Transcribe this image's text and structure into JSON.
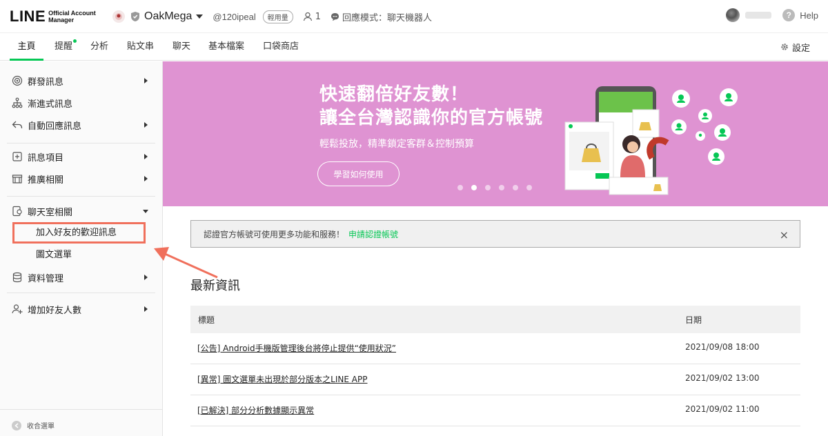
{
  "header": {
    "logo_main": "LINE",
    "logo_sub_1": "Official Account",
    "logo_sub_2": "Manager",
    "account_name": "OakMega",
    "account_id": "@120ipeal",
    "plan_badge": "輕用量",
    "friend_count": "1",
    "mode_label": "回應模式：聊天機器人",
    "help_label": "Help"
  },
  "tabs": [
    {
      "label": "主頁",
      "active": true
    },
    {
      "label": "提醒",
      "dot": true
    },
    {
      "label": "分析"
    },
    {
      "label": "貼文串"
    },
    {
      "label": "聊天"
    },
    {
      "label": "基本檔案"
    },
    {
      "label": "口袋商店"
    }
  ],
  "settings_label": "設定",
  "sidebar": {
    "items": [
      {
        "label": "群發訊息",
        "icon": "broadcast-icon"
      },
      {
        "label": "漸進式訊息",
        "icon": "step-message-icon"
      },
      {
        "label": "自動回應訊息",
        "icon": "reply-icon"
      },
      {
        "label": "訊息項目",
        "icon": "message-item-icon"
      },
      {
        "label": "推廣相關",
        "icon": "promotion-icon"
      },
      {
        "label": "聊天室相關",
        "icon": "chatroom-icon"
      },
      {
        "label": "資料管理",
        "icon": "database-icon"
      },
      {
        "label": "增加好友人數",
        "icon": "add-friend-icon"
      }
    ],
    "sub_items": [
      "加入好友的歡迎訊息",
      "圖文選單"
    ],
    "collapse_label": "收合選單"
  },
  "banner": {
    "headline_1": "快速翻倍好友數！",
    "headline_2": "讓全台灣認識你的官方帳號",
    "subtitle": "輕鬆投放，精準鎖定客群＆控制預算",
    "button": "學習如何使用",
    "slide_count": 6,
    "active_slide": 2,
    "background_color": "#df93d2"
  },
  "notice": {
    "text": "認證官方帳號可使用更多功能和服務！",
    "link": "申請認證帳號",
    "close": "×"
  },
  "news": {
    "title": "最新資訊",
    "columns": [
      "標題",
      "日期"
    ],
    "rows": [
      {
        "title": "[公告] Android手機版管理後台將停止提供“使用狀況”",
        "date": "2021/09/08 18:00"
      },
      {
        "title": "[異常] 圖文選單未出現於部分版本之LINE APP",
        "date": "2021/09/02 13:00"
      },
      {
        "title": "[已解決] 部分分析數據顯示異常",
        "date": "2021/09/02 11:00"
      }
    ]
  },
  "colors": {
    "accent": "#06c755",
    "highlight": "#f0705c"
  }
}
